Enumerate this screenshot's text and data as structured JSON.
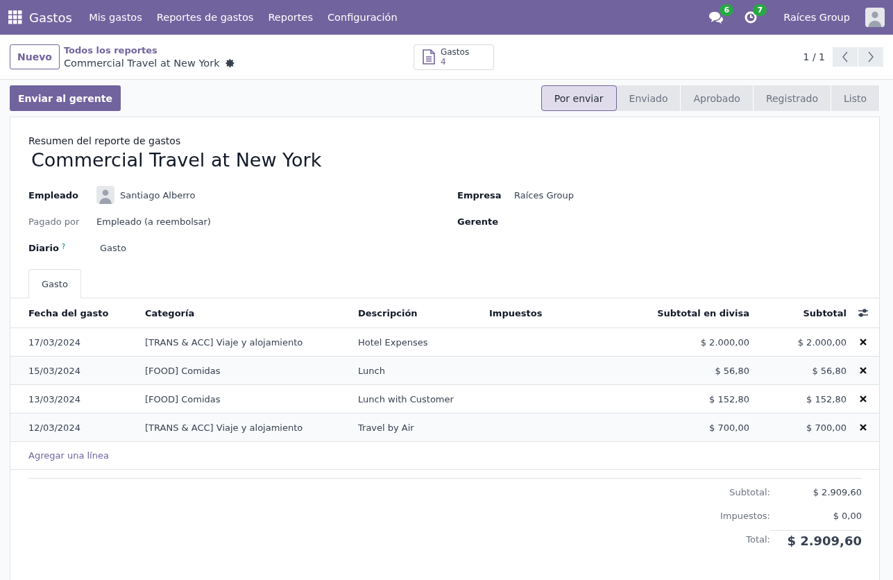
{
  "navbar": {
    "app": "Gastos",
    "menu": [
      "Mis gastos",
      "Reportes de gastos",
      "Reportes",
      "Configuración"
    ],
    "messages_count": "6",
    "activities_count": "7",
    "company": "Raíces Group"
  },
  "control_panel": {
    "new_button": "Nuevo",
    "breadcrumb": "Todos los reportes",
    "record": "Commercial Travel at New York",
    "smart_button": {
      "label": "Gastos",
      "count": "4"
    },
    "pager": "1 / 1"
  },
  "action_button": "Enviar al gerente",
  "statusbar": [
    {
      "label": "Por enviar",
      "selected": true
    },
    {
      "label": "Enviado",
      "selected": false
    },
    {
      "label": "Aprobado",
      "selected": false
    },
    {
      "label": "Registrado",
      "selected": false
    },
    {
      "label": "Listo",
      "selected": false
    }
  ],
  "form": {
    "subtitle": "Resumen del reporte de gastos",
    "title": "Commercial Travel at New York",
    "left_fields": [
      {
        "label": "Empleado",
        "value": "Santiago Alberro",
        "kind": "person"
      },
      {
        "label": "Pagado por",
        "value": "Empleado (a reembolsar)",
        "kind": "readonly"
      },
      {
        "label": "Diario",
        "value": "Gasto",
        "kind": "help",
        "help": "?"
      }
    ],
    "right_fields": [
      {
        "label": "Empresa",
        "value": "Raíces Group",
        "kind": "text"
      },
      {
        "label": "Gerente",
        "kind": "text"
      }
    ]
  },
  "tabs": [
    {
      "label": "Gasto",
      "selected": true
    }
  ],
  "table": {
    "columns": [
      "Fecha del gasto",
      "Categoría",
      "Descripción",
      "Impuestos",
      "Subtotal en divisa",
      "Subtotal"
    ],
    "rows": [
      {
        "cells": [
          "17/03/2024",
          "[TRANS & ACC] Viaje y alojamiento",
          "Hotel Expenses",
          "",
          "$ 2.000,00",
          "$ 2.000,00"
        ]
      },
      {
        "cells": [
          "15/03/2024",
          "[FOOD] Comidas",
          "Lunch",
          "",
          "$ 56,80",
          "$ 56,80"
        ]
      },
      {
        "cells": [
          "13/03/2024",
          "[FOOD] Comidas",
          "Lunch with Customer",
          "",
          "$ 152,80",
          "$ 152,80"
        ]
      },
      {
        "cells": [
          "12/03/2024",
          "[TRANS & ACC] Viaje y alojamiento",
          "Travel by Air",
          "",
          "$ 700,00",
          "$ 700,00"
        ]
      }
    ],
    "add_line": "Agregar una línea"
  },
  "totals": [
    {
      "label": "Subtotal:",
      "value": "$ 2.909,60",
      "kind": "normal"
    },
    {
      "label": "Impuestos:",
      "value": "$ 0,00",
      "kind": "normal"
    },
    {
      "label": "Total:",
      "value": "$ 2.909,60",
      "kind": "grand"
    }
  ]
}
